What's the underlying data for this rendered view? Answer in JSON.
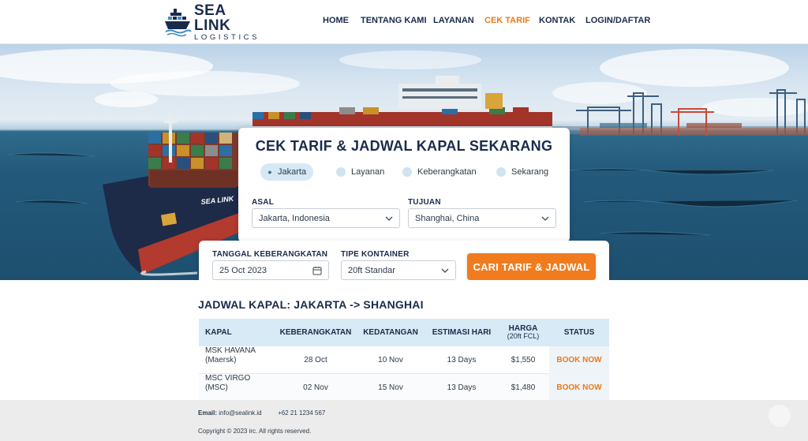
{
  "brand": {
    "name": "SEA LINK",
    "tagline": "LOGISTICS"
  },
  "nav": [
    {
      "label": "HOME",
      "active": false
    },
    {
      "label": "TENTANG KAMI",
      "active": false
    },
    {
      "label": "LAYANAN",
      "active": false
    },
    {
      "label": "CEK TARIF",
      "active": true
    },
    {
      "label": "KONTAK",
      "active": false
    },
    {
      "label": "LOGIN/DAFTAR",
      "active": false
    }
  ],
  "hero": {
    "ship_name": "SEA LINK"
  },
  "search": {
    "title": "CEK TARIF & JADWAL KAPAL SEKARANG",
    "tabs": [
      {
        "label": "Jakarta",
        "active": true
      },
      {
        "label": "Layanan",
        "active": false
      },
      {
        "label": "Keberangkatan",
        "active": false
      },
      {
        "label": "Sekarang",
        "active": false
      }
    ],
    "origin": {
      "label": "ASAL",
      "value": "Jakarta, Indonesia"
    },
    "destination": {
      "label": "TUJUAN",
      "value": "Shanghai, China"
    },
    "departure_date": {
      "label": "TANGGAL KEBERANGKATAN",
      "value": "25 Oct 2023"
    },
    "container_type": {
      "label": "TIPE KONTAINER",
      "value": "20ft Standar"
    },
    "submit_label": "CARI TARIF & JADWAL"
  },
  "schedule": {
    "title": "JADWAL KAPAL: JAKARTA -> SHANGHAI",
    "columns": {
      "ship": "KAPAL",
      "departure": "KEBERANGKATAN",
      "arrival": "KEDATANGAN",
      "days": "ESTIMASI HARI",
      "price": "HARGA",
      "price_sub": "(20ft FCL)",
      "status": "STATUS"
    },
    "rows": [
      {
        "ship": "MSK HAVANA",
        "carrier": "(Maersk)",
        "departure": "28 Oct",
        "arrival": "10 Nov",
        "days": "13 Days",
        "price": "$1,550",
        "action": "BOOK NOW"
      },
      {
        "ship": "MSC VIRGO",
        "carrier": "(MSC)",
        "departure": "02 Nov",
        "arrival": "15 Nov",
        "days": "13 Days",
        "price": "$1,480",
        "action": "BOOK NOW"
      }
    ]
  },
  "footer": {
    "email_label": "Email:",
    "email": "info@sealink.id",
    "phone": "+62 21 1234 567",
    "copyright": "Copyright © 2023 irc. All rights reserved."
  },
  "colors": {
    "brand_navy": "#1a2b4c",
    "accent_orange": "#f07c1f",
    "table_header": "#d8eaf5"
  }
}
